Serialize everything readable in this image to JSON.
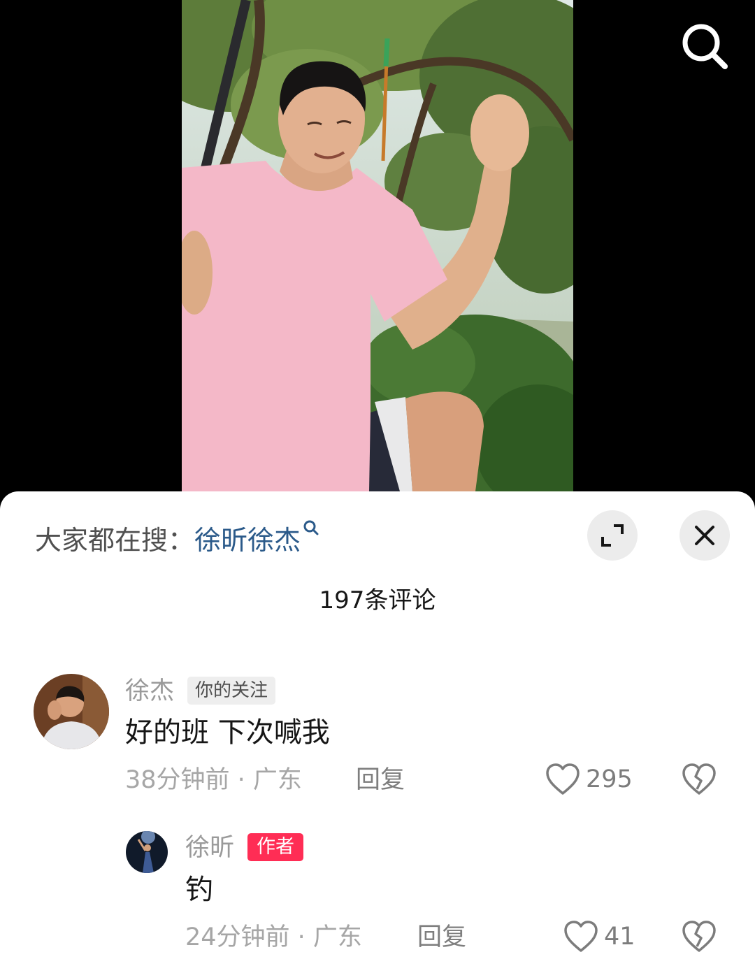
{
  "top": {
    "search_icon": "search-icon"
  },
  "panel": {
    "trending_label": "大家都在搜：",
    "trending_query": "徐昕徐杰",
    "comment_count": "197条评论"
  },
  "comments": [
    {
      "author": "徐杰",
      "badge": "你的关注",
      "text": "好的班 下次喊我",
      "time_location": "38分钟前 · 广东",
      "reply_label": "回复",
      "likes": "295"
    },
    {
      "author": "徐昕",
      "badge": "作者",
      "text": "钓",
      "time_location": "24分钟前 · 广东",
      "reply_label": "回复",
      "likes": "41"
    }
  ],
  "colors": {
    "author_badge": "#ff2d55",
    "trend_link": "#2b5a8a"
  }
}
